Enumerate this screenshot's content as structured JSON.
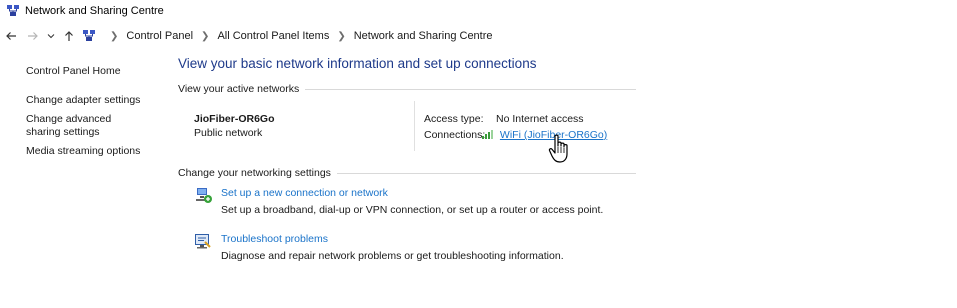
{
  "window": {
    "title": "Network and Sharing Centre"
  },
  "addressbar": {
    "breadcrumbs": [
      "Control Panel",
      "All Control Panel Items",
      "Network and Sharing Centre"
    ]
  },
  "sidebar": {
    "items": [
      {
        "label": "Control Panel Home"
      },
      {
        "label": "Change adapter settings"
      },
      {
        "label": "Change advanced sharing settings"
      },
      {
        "label": "Media streaming options"
      }
    ]
  },
  "main": {
    "title": "View your basic network information and set up connections",
    "active_section": "View your active networks",
    "network": {
      "name": "JioFiber-OR6Go",
      "category": "Public network",
      "access_type_label": "Access type:",
      "access_type_value": "No Internet access",
      "connections_label": "Connections:",
      "connection_link": "WiFi (JioFiber-OR6Go)"
    },
    "settings_section": "Change your networking settings",
    "tasks": [
      {
        "link": "Set up a new connection or network",
        "desc": "Set up a broadband, dial-up or VPN connection, or set up a router or access point.",
        "icon": "new-connection-icon"
      },
      {
        "link": "Troubleshoot problems",
        "desc": "Diagnose and repair network problems or get troubleshooting information.",
        "icon": "troubleshoot-icon"
      }
    ]
  },
  "colors": {
    "link": "#1a73c9",
    "title": "#1e3a8a"
  }
}
